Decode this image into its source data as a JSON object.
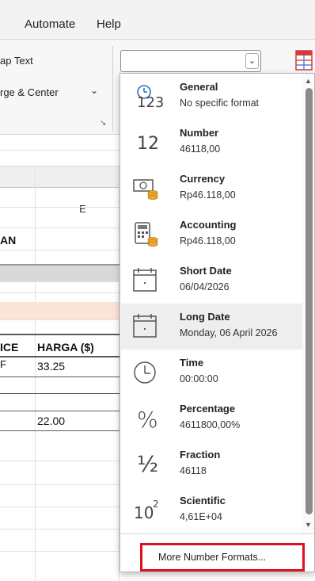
{
  "ribbon_tabs": {
    "automate": "Automate",
    "help": "Help"
  },
  "ribbon": {
    "wrap_text": "ap Text",
    "merge_center": "rge & Center",
    "merge_chevron": "⌄",
    "launcher_glyph": "↘",
    "format_combo_value": "",
    "combo_arrow": "⌄"
  },
  "sheet": {
    "column_e": "E",
    "title_fragment": "AN",
    "header_price": "ICE",
    "header_harga": "HARGA ($)",
    "row1_price": "F",
    "row1_harga": "33.25",
    "row4_harga": "22.00",
    "highlight_color": "#fbe3d6",
    "gray_band_color": "#d9d9d9"
  },
  "number_formats": {
    "items": [
      {
        "name": "General",
        "value": "No specific format",
        "icon": "clock-123-icon"
      },
      {
        "name": "Number",
        "value": "46118,00",
        "icon": "number-12-icon"
      },
      {
        "name": "Currency",
        "value": "Rp46.118,00",
        "icon": "currency-icon"
      },
      {
        "name": "Accounting",
        "value": "Rp46.118,00",
        "icon": "accounting-icon"
      },
      {
        "name": "Short Date",
        "value": "06/04/2026",
        "icon": "calendar-icon"
      },
      {
        "name": "Long Date",
        "value": "Monday, 06 April 2026",
        "icon": "calendar-icon"
      },
      {
        "name": "Time",
        "value": "00:00:00",
        "icon": "clock-icon"
      },
      {
        "name": "Percentage",
        "value": "4611800,00%",
        "icon": "percent-icon"
      },
      {
        "name": "Fraction",
        "value": "46118",
        "icon": "fraction-icon"
      },
      {
        "name": "Scientific",
        "value": "4,61E+04",
        "icon": "scientific-icon"
      }
    ],
    "highlighted": "Long Date",
    "icon_text": {
      "general": "123",
      "number": "12",
      "percent": "%",
      "fraction": "½",
      "scientific_base": "10",
      "scientific_exp": "2"
    },
    "more_formats": "More Number Formats...",
    "highlight_border_color": "#e0101f"
  }
}
